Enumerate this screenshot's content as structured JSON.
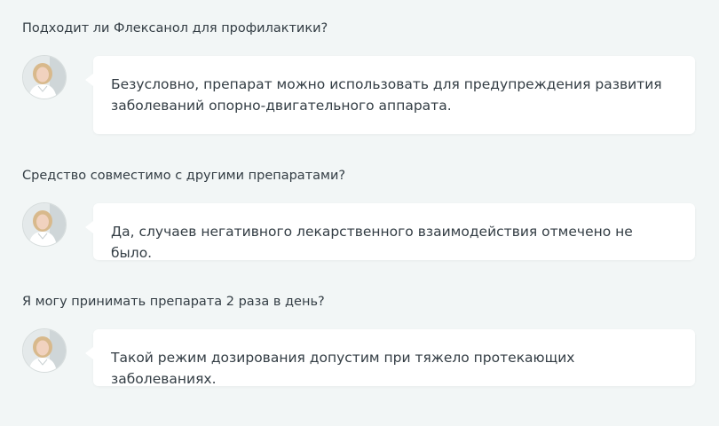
{
  "faq": [
    {
      "question": "Подходит ли Флексанол для профилактики?",
      "answer": "Безусловно, препарат можно использовать для предупреждения развития заболеваний опорно-двигательного аппарата.",
      "avatar_icon": "doctor-photo"
    },
    {
      "question": "Средство совместимо с другими препаратами?",
      "answer": "Да, случаев негативного лекарственного взаимодействия отмечено не было.",
      "avatar_icon": "doctor-photo"
    },
    {
      "question": "Я могу принимать препарата 2 раза в день?",
      "answer": "Такой режим дозирования допустим при тяжело протекающих заболеваниях.",
      "avatar_icon": "doctor-photo"
    }
  ],
  "colors": {
    "background": "#f2f6f6",
    "bubble": "#ffffff",
    "text": "#333d44"
  }
}
